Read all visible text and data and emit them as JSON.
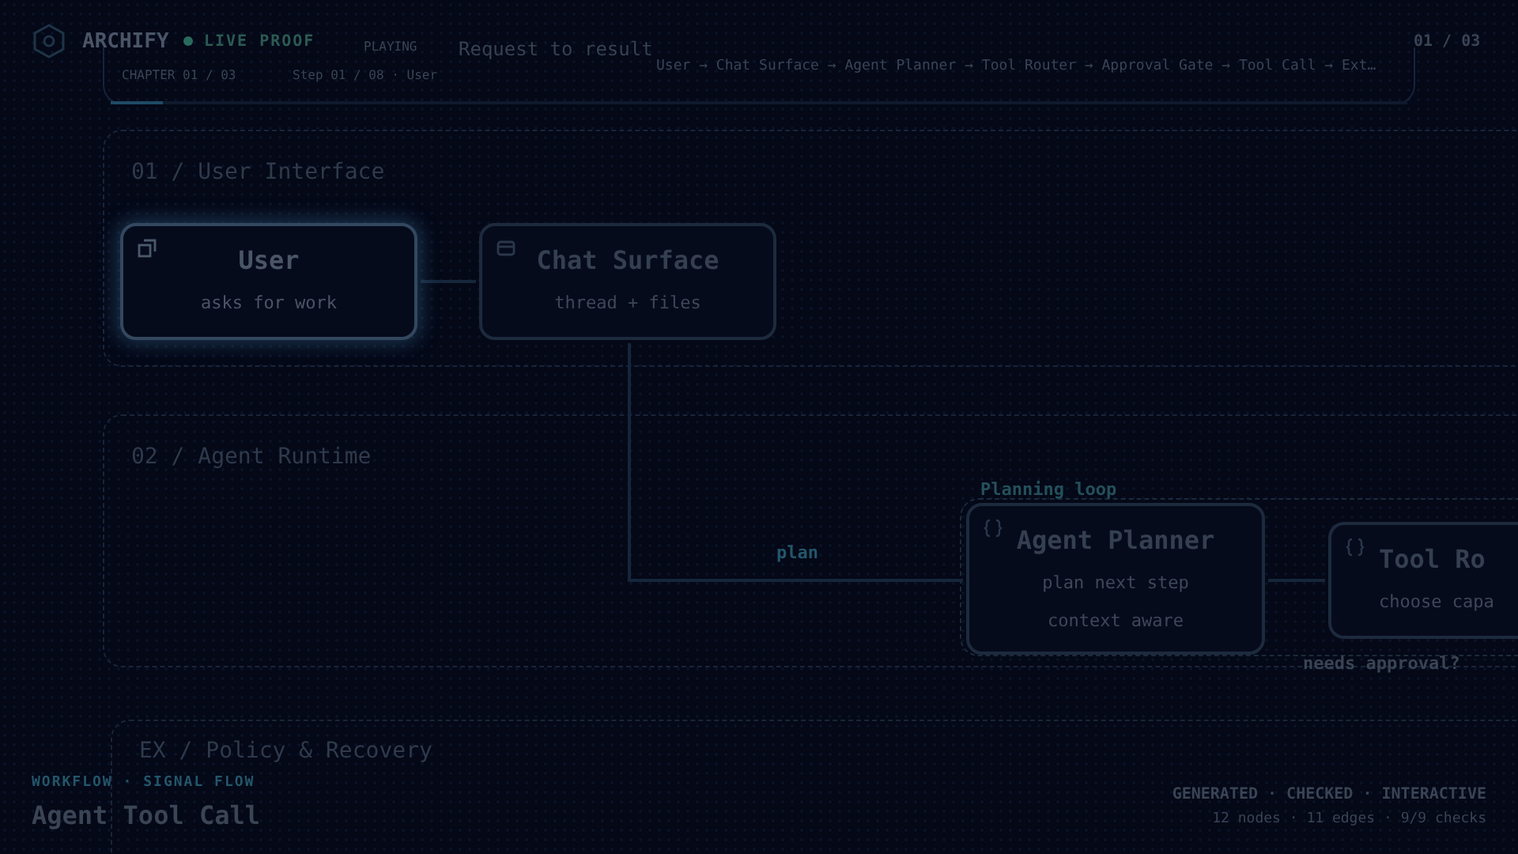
{
  "header": {
    "brand": "ARCHIFY",
    "status": "LIVE PROOF",
    "live": true,
    "page": "01 / 03"
  },
  "player": {
    "state": "PLAYING",
    "title": "Request to result",
    "chapter": "CHAPTER 01 / 03",
    "step": "Step 01 / 08 · User",
    "path": "User → Chat Surface → Agent Planner → Tool Router → Approval Gate → Tool Call → Ext…",
    "level": 0.04
  },
  "groups": [
    {
      "title": "01 / User Interface"
    },
    {
      "title": "02 / Agent Runtime"
    },
    {
      "title": "EX / Policy & Recovery"
    }
  ],
  "loop": {
    "label": "Planning loop"
  },
  "nodes": [
    {
      "kind": "person",
      "title": "User",
      "subtitle": "asks for work",
      "selected": true
    },
    {
      "kind": "window",
      "title": "Chat Surface",
      "subtitle": "thread + files",
      "selected": false
    },
    {
      "kind": "code",
      "title": "Agent Planner",
      "subtitle": "plan next step",
      "note": "context aware",
      "selected": false
    },
    {
      "kind": "code",
      "title": "Tool Ro",
      "subtitle": "choose capa",
      "selected": false
    }
  ],
  "edge_labels": [
    {
      "text": "plan"
    },
    {
      "text": "needs approval?"
    }
  ],
  "footer": {
    "eyebrow": "WORKFLOW · SIGNAL FLOW",
    "title": "Agent Tool Call",
    "badges": "GENERATED · CHECKED · INTERACTIVE",
    "stats": "12 nodes · 11 edges · 9/9 checks"
  }
}
